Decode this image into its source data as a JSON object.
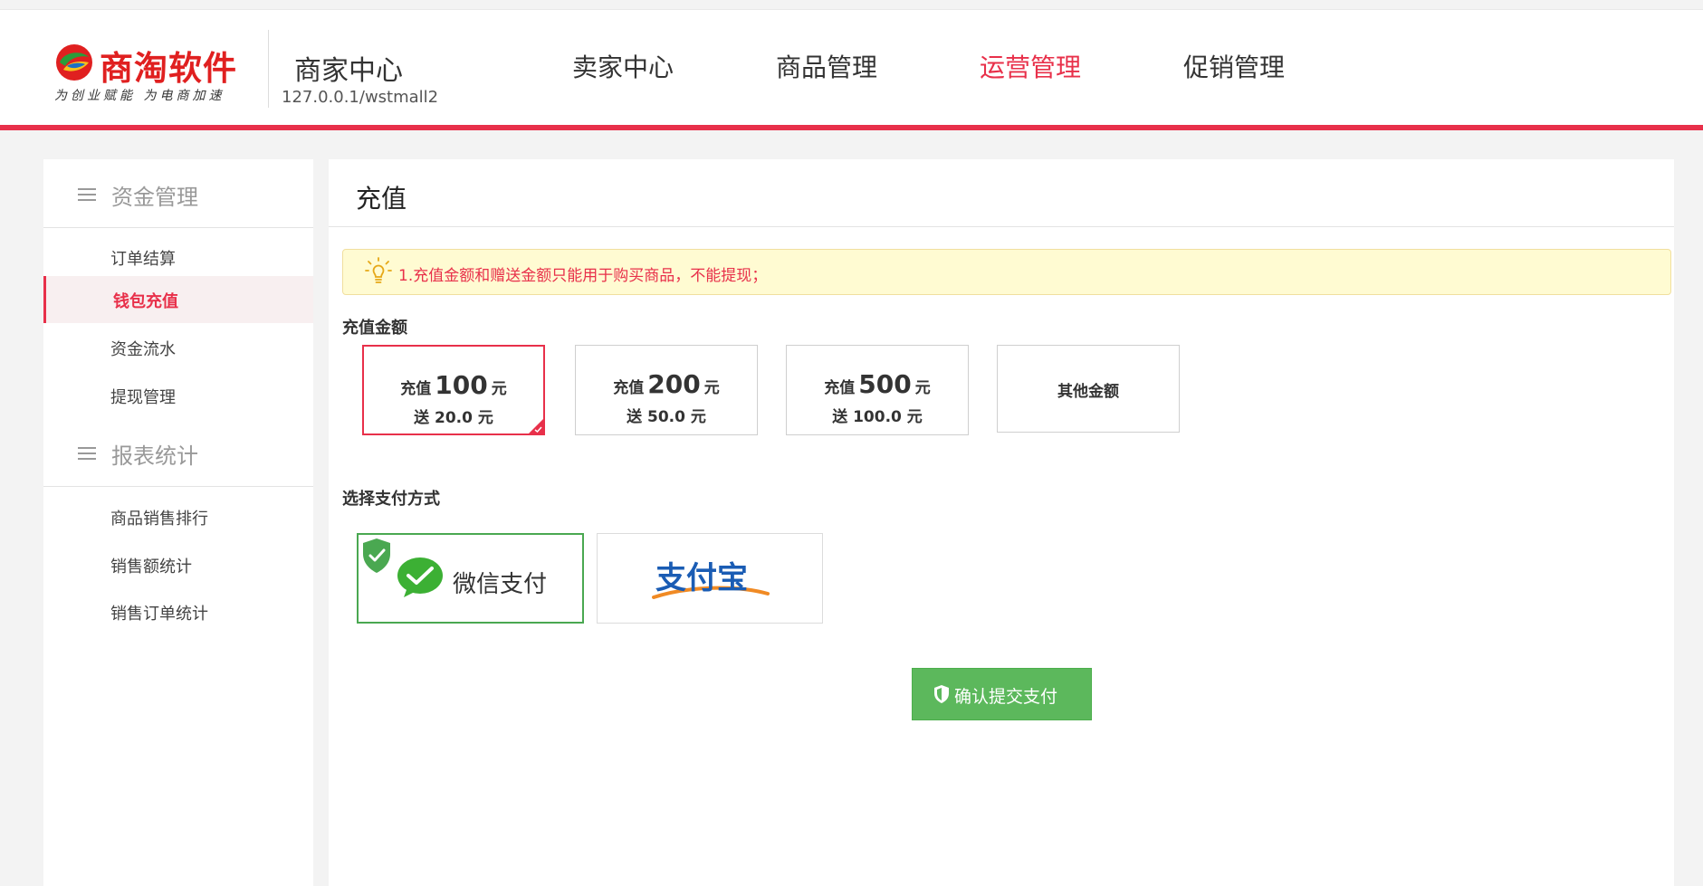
{
  "header": {
    "logo_name": "商淘软件",
    "logo_slogan": "为创业赋能 为电商加速",
    "center_title": "商家中心",
    "center_url": "127.0.0.1/wstmall2",
    "nav": [
      {
        "label": "卖家中心",
        "active": false
      },
      {
        "label": "商品管理",
        "active": false
      },
      {
        "label": "运营管理",
        "active": true
      },
      {
        "label": "促销管理",
        "active": false
      }
    ]
  },
  "sidebar": {
    "sections": [
      {
        "title": "资金管理",
        "items": [
          {
            "label": "订单结算",
            "active": false
          },
          {
            "label": "钱包充值",
            "active": true
          },
          {
            "label": "资金流水",
            "active": false
          },
          {
            "label": "提现管理",
            "active": false
          }
        ]
      },
      {
        "title": "报表统计",
        "items": [
          {
            "label": "商品销售排行",
            "active": false
          },
          {
            "label": "销售额统计",
            "active": false
          },
          {
            "label": "销售订单统计",
            "active": false
          }
        ]
      }
    ]
  },
  "main": {
    "title": "充值",
    "notice": "1.充值金额和赠送金额只能用于购买商品，不能提现；",
    "amount_label": "充值金额",
    "amounts": [
      {
        "prefix": "充值",
        "value": "100",
        "unit": "元",
        "bonus": "送 20.0 元",
        "selected": true
      },
      {
        "prefix": "充值",
        "value": "200",
        "unit": "元",
        "bonus": "送 50.0 元",
        "selected": false
      },
      {
        "prefix": "充值",
        "value": "500",
        "unit": "元",
        "bonus": "送 100.0 元",
        "selected": false
      }
    ],
    "other_amount_label": "其他金额",
    "payment_label": "选择支付方式",
    "payment_methods": {
      "wechat": {
        "label": "微信支付",
        "selected": true
      },
      "alipay": {
        "label": "支付宝",
        "selected": false
      }
    },
    "submit_label": "确认提交支付"
  },
  "colors": {
    "accent": "#e8304a",
    "success": "#5cb85c",
    "notice_bg": "#fffbd2",
    "alipay_blue": "#1a5cb4",
    "alipay_orange": "#f08a24"
  }
}
